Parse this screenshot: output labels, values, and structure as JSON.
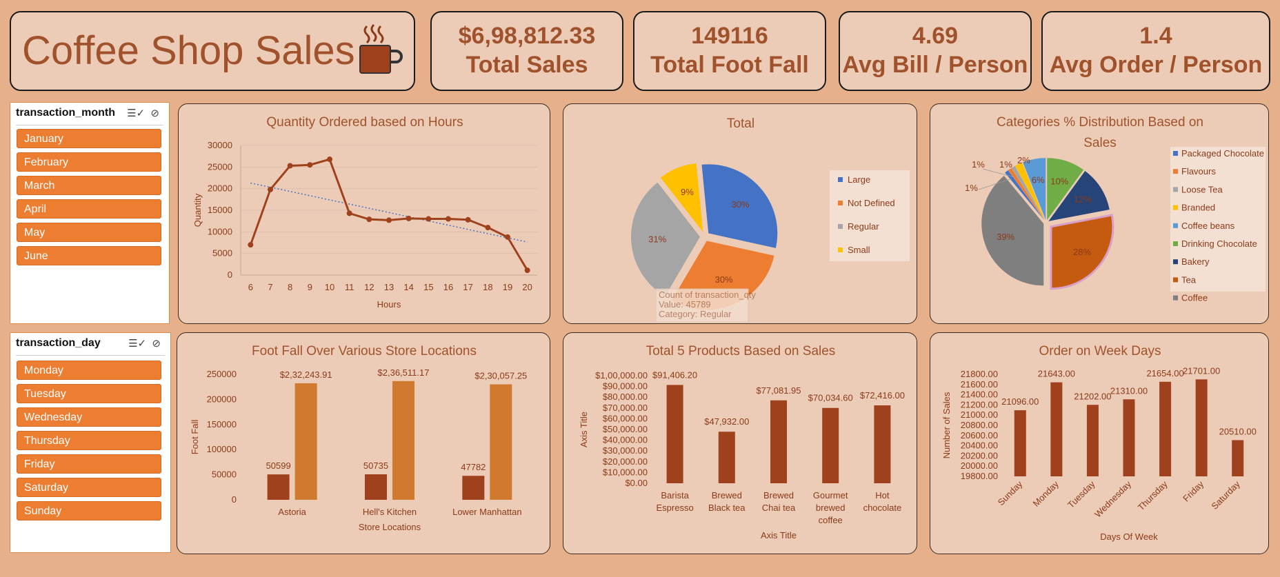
{
  "header": {
    "title": "Coffee Shop Sales",
    "icon": "coffee-cup-icon"
  },
  "kpis": [
    {
      "value": "$6,98,812.33",
      "label": "Total Sales"
    },
    {
      "value": "149116",
      "label": "Total Foot Fall"
    },
    {
      "value": "4.69",
      "label": "Avg Bill / Person"
    },
    {
      "value": "1.4",
      "label": "Avg Order / Person"
    }
  ],
  "slicers": {
    "month": {
      "header": "transaction_month",
      "items": [
        "January",
        "February",
        "March",
        "April",
        "May",
        "June"
      ]
    },
    "day": {
      "header": "transaction_day",
      "items": [
        "Monday",
        "Tuesday",
        "Wednesday",
        "Thursday",
        "Friday",
        "Saturday",
        "Sunday"
      ]
    }
  },
  "colors": {
    "background": "#e6b08b",
    "panel": "#ecccb6",
    "accent": "#a0522d",
    "slicer_item": "#ed7d31"
  },
  "chart_data": [
    {
      "id": "hours",
      "type": "line",
      "title": "Quantity Ordered based on Hours",
      "xlabel": "Hours",
      "ylabel": "Quantity",
      "categories": [
        "6",
        "7",
        "8",
        "9",
        "10",
        "11",
        "12",
        "13",
        "14",
        "15",
        "16",
        "17",
        "18",
        "19",
        "20"
      ],
      "values": [
        7000,
        19800,
        25300,
        25500,
        26800,
        14300,
        12900,
        12700,
        13100,
        13000,
        13000,
        12800,
        11000,
        8800,
        1100
      ],
      "trendline": "linear",
      "ylim": [
        0,
        30000
      ],
      "yticks": [
        "0",
        "5000",
        "10000",
        "15000",
        "20000",
        "25000",
        "30000"
      ],
      "grid": true
    },
    {
      "id": "size",
      "type": "pie",
      "title": "Total",
      "labels": [
        "Large",
        "Not Defined",
        "Regular",
        "Small"
      ],
      "values": [
        30,
        30,
        31,
        9
      ],
      "value_labels": [
        "30%",
        "30%",
        "31%",
        "9%"
      ],
      "colors": [
        "#4472c4",
        "#ed7d31",
        "#a5a5a5",
        "#ffc000"
      ],
      "legend": "right",
      "tooltip": [
        "Count of transaction_qty",
        "Value: 45789",
        "Category: Regular"
      ]
    },
    {
      "id": "categories",
      "type": "pie",
      "title": "Categories % Distribution Based on Sales",
      "labels": [
        "Packaged Chocolate",
        "Flavours",
        "Loose Tea",
        "Branded",
        "Coffee beans",
        "Drinking Chocolate",
        "Bakery",
        "Tea",
        "Coffee"
      ],
      "values": [
        1,
        1,
        1,
        2,
        6,
        10,
        12,
        28,
        39
      ],
      "value_labels": [
        "1%",
        "1%",
        "1%",
        "2%",
        "6%",
        "10%",
        "12%",
        "28%",
        "39%"
      ],
      "colors": [
        "#4472c4",
        "#ed7d31",
        "#a5a5a5",
        "#ffc000",
        "#5b9bd5",
        "#70ad47",
        "#264478",
        "#c55a11",
        "#7f7f7f"
      ],
      "legend": "right"
    },
    {
      "id": "footfall",
      "type": "bar",
      "title": "Foot Fall Over Various Store Locations",
      "xlabel": "Store Locations",
      "ylabel": "Foot Fall",
      "categories": [
        "Astoria",
        "Hell's Kitchen",
        "Lower Manhattan"
      ],
      "series": [
        {
          "values": [
            50599,
            50735,
            47782
          ],
          "labels": [
            "50599",
            "50735",
            "47782"
          ],
          "color": "#a0411e"
        },
        {
          "values": [
            232243.91,
            236511.17,
            230057.25
          ],
          "labels": [
            "$2,32,243.91",
            "$2,36,511.17",
            "$2,30,057.25"
          ],
          "color": "#d07a30"
        }
      ],
      "ylim": [
        0,
        250000
      ],
      "yticks": [
        "0",
        "50000",
        "100000",
        "150000",
        "200000",
        "250000"
      ]
    },
    {
      "id": "products",
      "type": "bar",
      "title": "Total 5 Products Based on Sales",
      "xlabel": "Axis Title",
      "ylabel": "Axis Title",
      "categories": [
        "Barista Espresso",
        "Brewed Black tea",
        "Brewed Chai tea",
        "Gourmet brewed coffee",
        "Hot chocolate"
      ],
      "category_lines": [
        [
          "Barista",
          "Espresso"
        ],
        [
          "Brewed",
          "Black tea"
        ],
        [
          "Brewed",
          "Chai tea"
        ],
        [
          "Gourmet",
          "brewed",
          "coffee"
        ],
        [
          "Hot",
          "chocolate"
        ]
      ],
      "values": [
        91406.2,
        47932.0,
        77081.95,
        70034.6,
        72416.0
      ],
      "labels": [
        "$91,406.20",
        "$47,932.00",
        "$77,081.95",
        "$70,034.60",
        "$72,416.00"
      ],
      "ylim": [
        0,
        100000
      ],
      "yticks": [
        "$0.00",
        "$10,000.00",
        "$20,000.00",
        "$30,000.00",
        "$40,000.00",
        "$50,000.00",
        "$60,000.00",
        "$70,000.00",
        "$80,000.00",
        "$90,000.00",
        "$1,00,000.00"
      ]
    },
    {
      "id": "weekdays",
      "type": "bar",
      "title": "Order on Week Days",
      "xlabel": "Days Of Week",
      "ylabel": "Number of Sales",
      "categories": [
        "Sunday",
        "Monday",
        "Tuesday",
        "Wednesday",
        "Thursday",
        "Friday",
        "Saturday"
      ],
      "values": [
        21096,
        21643,
        21202,
        21310,
        21654,
        21701,
        20510
      ],
      "labels": [
        "21096.00",
        "21643.00",
        "21202.00",
        "21310.00",
        "21654.00",
        "21701.00",
        "20510.00"
      ],
      "ylim": [
        19800,
        21800
      ],
      "yticks": [
        "19800.00",
        "20000.00",
        "20200.00",
        "20400.00",
        "20600.00",
        "20800.00",
        "21000.00",
        "21200.00",
        "21400.00",
        "21600.00",
        "21800.00"
      ]
    }
  ]
}
